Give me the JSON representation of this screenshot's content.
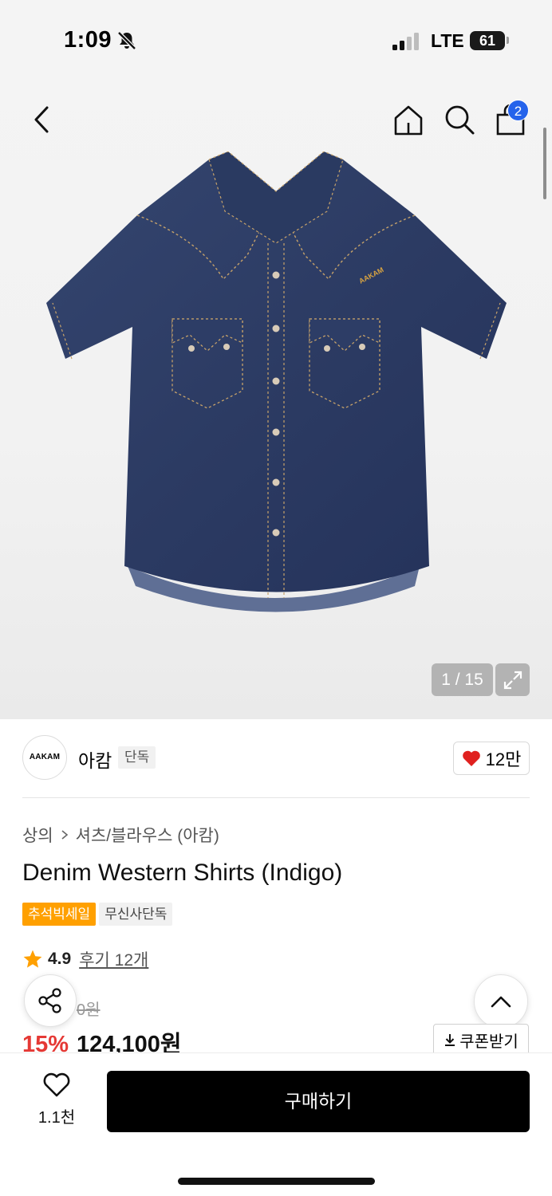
{
  "status_bar": {
    "time": "1:09",
    "carrier": "LTE",
    "battery": "61",
    "icons": [
      "bell-slash-icon",
      "signal-icon"
    ]
  },
  "nav": {
    "icons": [
      "chevron-left-icon",
      "home-icon",
      "search-icon",
      "shopping-bag-icon"
    ],
    "cart_count": "2"
  },
  "gallery": {
    "pager": "1 / 15",
    "expand_icon": "expand-icon",
    "image_label": "AAKAM"
  },
  "brand": {
    "logo_text": "AAKAM",
    "name": "아캄",
    "exclusive_tag": "단독",
    "like_count": "12만",
    "like_color": "#e0211f"
  },
  "product": {
    "breadcrumb": [
      "상의",
      "셔츠/블라우스 (아캄)"
    ],
    "title": "Denim Western Shirts (Indigo)",
    "tags": [
      "추석빅세일",
      "무신사단독"
    ],
    "rating": "4.9",
    "review_link": "후기 12개",
    "original_price": "0원",
    "discount": "15%",
    "sale_price": "124,100원",
    "coupon_label": "쿠폰받기"
  },
  "bottom_bar": {
    "wish_count": "1.1천",
    "buy_label": "구매하기"
  },
  "colors": {
    "accent_blue": "#2563eb",
    "sale_orange": "#ffa000",
    "discount_red": "#e53935",
    "star": "#ffa000"
  }
}
